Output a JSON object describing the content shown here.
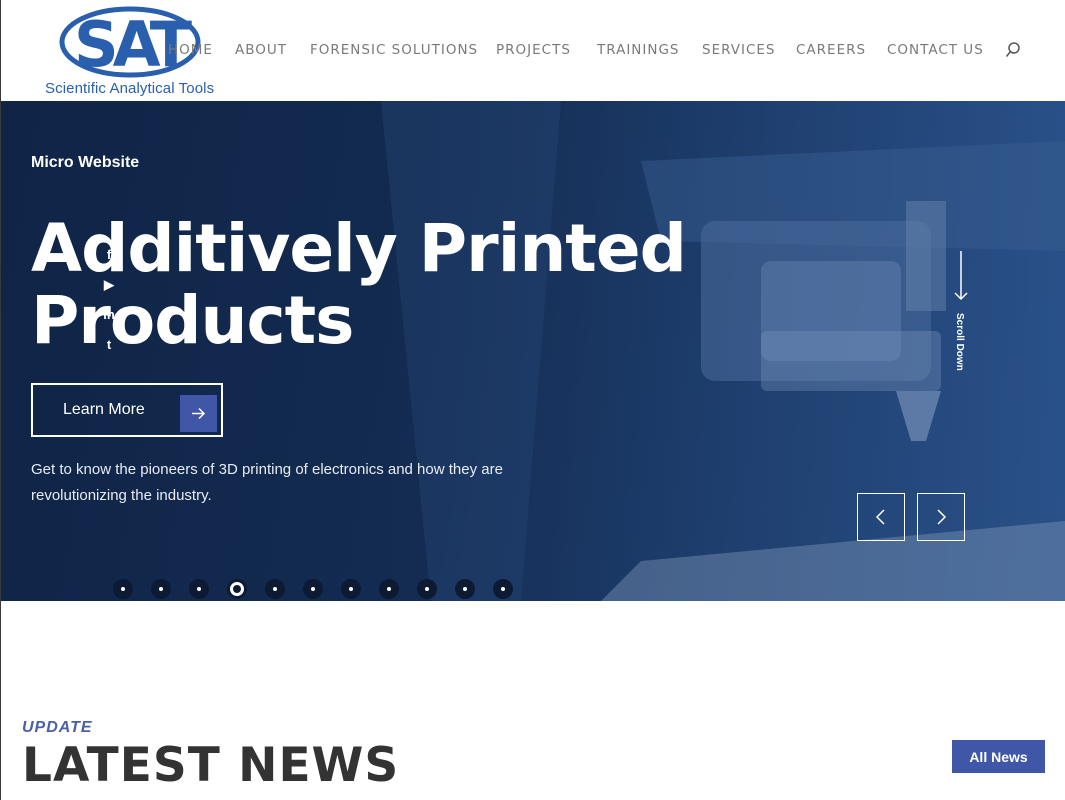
{
  "brand": {
    "logo_letters": "SAT",
    "tagline": "Scientific Analytical Tools",
    "color": "#2a5fae"
  },
  "nav": {
    "items": [
      {
        "label": "HOME"
      },
      {
        "label": "ABOUT"
      },
      {
        "label": "FORENSIC SOLUTIONS"
      },
      {
        "label": "PROJECTS"
      },
      {
        "label": "TRAININGS"
      },
      {
        "label": "SERVICES"
      },
      {
        "label": "CAREERS"
      },
      {
        "label": "CONTACT US"
      }
    ],
    "search_icon": "search-icon"
  },
  "hero": {
    "eyebrow": "Micro Website",
    "headline_line1": "Additively Printed",
    "headline_line2": "Products",
    "cta_label": "Learn More",
    "description": "Get to know the pioneers of 3D printing of electronics and how they are revolutionizing the industry.",
    "scroll_label": "Scroll Down",
    "social_icons": [
      "facebook-icon",
      "youtube-icon",
      "linkedin-icon",
      "twitter-icon"
    ],
    "social_glyphs": [
      "f",
      "▶",
      "in",
      "t"
    ],
    "slide_count": 11,
    "active_slide": 4,
    "accent_color": "#3f57a6"
  },
  "news": {
    "eyebrow": "UPDATE",
    "title": "LATEST NEWS",
    "button_label": "All News"
  }
}
